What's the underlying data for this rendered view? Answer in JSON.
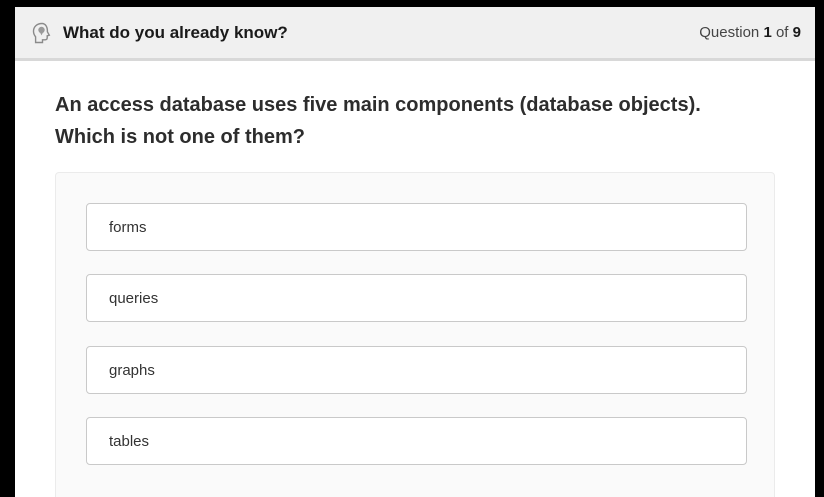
{
  "header": {
    "icon": "head-thinking-icon",
    "title": "What do you already know?",
    "counter": {
      "prefix": "Question",
      "current": "1",
      "of_label": "of",
      "total": "9"
    }
  },
  "question": {
    "line1": "An access database uses five main components (database objects).",
    "line2": "Which is not one of them?"
  },
  "options": [
    {
      "label": "forms"
    },
    {
      "label": "queries"
    },
    {
      "label": "graphs"
    },
    {
      "label": "tables"
    }
  ],
  "colors": {
    "header_bg": "#f0f0f0",
    "border": "#c9c9c9",
    "text": "#2d2d2d"
  }
}
